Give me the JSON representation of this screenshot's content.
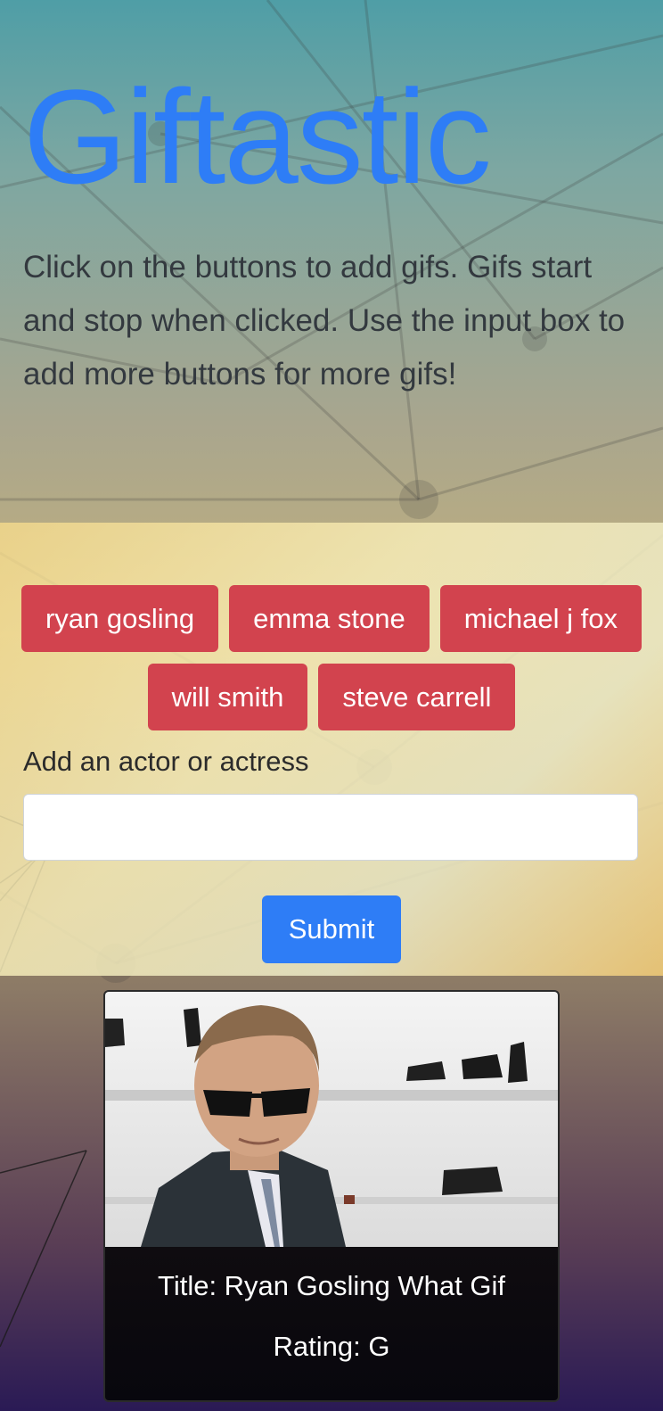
{
  "header": {
    "title": "Giftastic",
    "description": "Click on the buttons to add gifs. Gifs start and stop when clicked. Use the input box to add more buttons for more gifs!"
  },
  "buttons": [
    "ryan gosling",
    "emma stone",
    "michael j fox",
    "will smith",
    "steve carrell"
  ],
  "form": {
    "label": "Add an actor or actress",
    "input_value": "",
    "input_placeholder": "",
    "submit_label": "Submit"
  },
  "gif": {
    "title": "Title: Ryan Gosling What Gif",
    "rating": "Rating: G"
  },
  "colors": {
    "title": "#2e7df6",
    "actor_button": "#d2434e",
    "submit_button": "#2e7df6"
  },
  "icons": []
}
